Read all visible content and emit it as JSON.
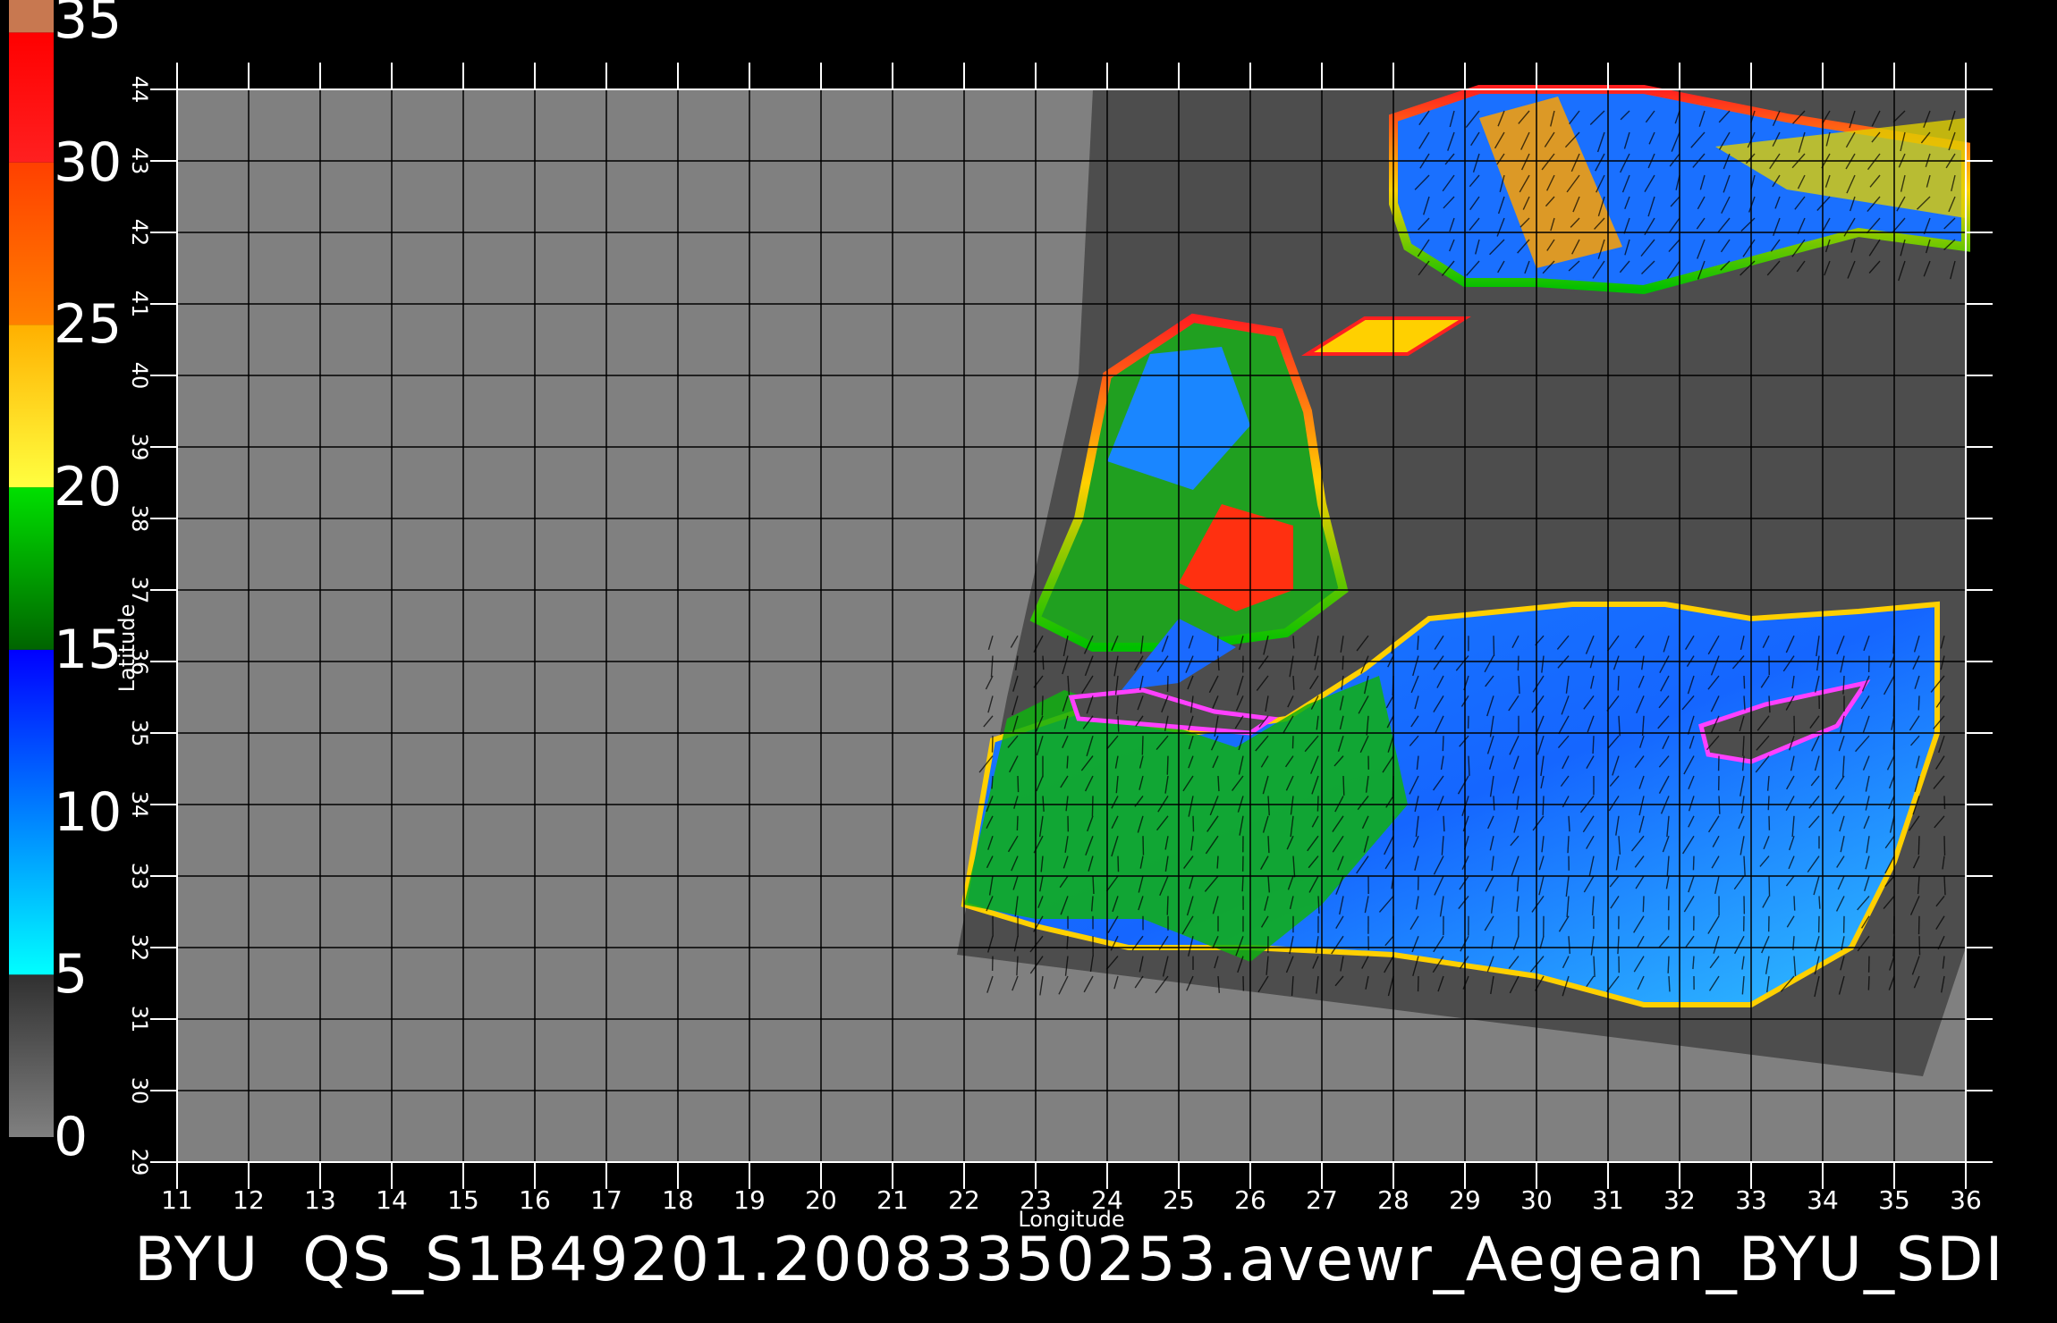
{
  "map": {
    "kind": "scatterometer wind speed field",
    "region": "Aegean / Eastern Mediterranean",
    "longitude_range": [
      11,
      36
    ],
    "latitude_range": [
      29,
      44
    ],
    "grid": true,
    "background_color": "#808080",
    "swath_color": "#4d4d4d"
  },
  "axes": {
    "x_label": "Longitude",
    "y_label": "Latitude",
    "x_ticks": [
      "11",
      "12",
      "13",
      "14",
      "15",
      "16",
      "17",
      "18",
      "19",
      "20",
      "21",
      "22",
      "23",
      "24",
      "25",
      "26",
      "27",
      "28",
      "29",
      "30",
      "31",
      "32",
      "33",
      "34",
      "35",
      "36"
    ],
    "y_ticks": [
      "29",
      "30",
      "31",
      "32",
      "33",
      "34",
      "35",
      "36",
      "37",
      "38",
      "39",
      "40",
      "41",
      "42",
      "43",
      "44"
    ]
  },
  "colorbar": {
    "labels": [
      "35",
      "30",
      "25",
      "20",
      "15",
      "10",
      "5",
      "0"
    ],
    "segments": [
      {
        "from": 0,
        "to": 5,
        "colors": [
          "#808080",
          "#303030"
        ]
      },
      {
        "from": 5,
        "to": 15,
        "colors": [
          "#00ffff",
          "#0000ff"
        ]
      },
      {
        "from": 15,
        "to": 20,
        "colors": [
          "#006400",
          "#00e000"
        ]
      },
      {
        "from": 20,
        "to": 25,
        "colors": [
          "#ffff40",
          "#ffb000"
        ]
      },
      {
        "from": 25,
        "to": 30,
        "colors": [
          "#ff8000",
          "#ff4000"
        ]
      },
      {
        "from": 30,
        "to": 34,
        "colors": [
          "#ff2020",
          "#ff0000"
        ]
      },
      {
        "from": 34,
        "to": 35,
        "colors": [
          "#c87850",
          "#c87850"
        ]
      }
    ]
  },
  "footer": {
    "source": "BYU",
    "product": "QS_S1B49201.20083350253.avewr_Aegean_BYU_SDI"
  }
}
